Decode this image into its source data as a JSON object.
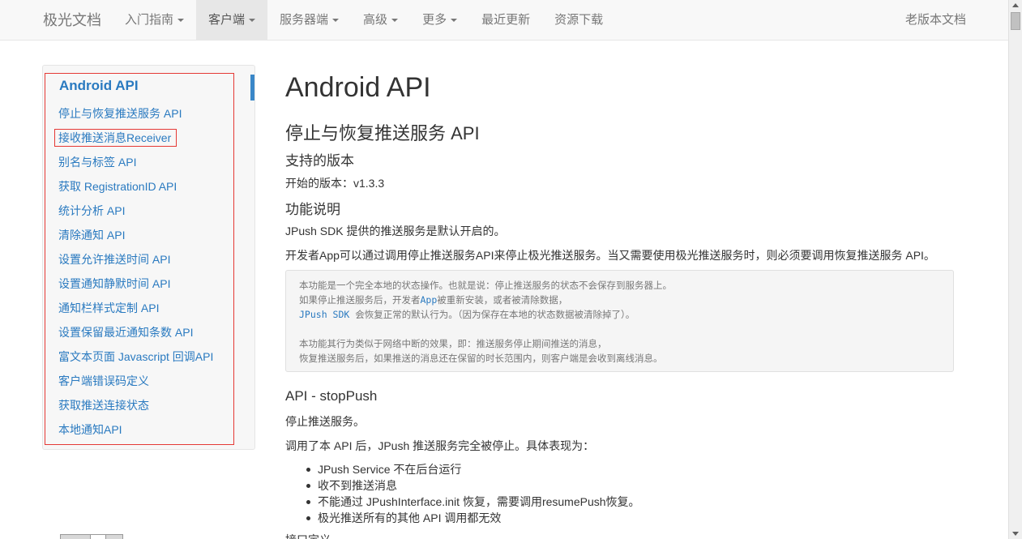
{
  "navbar": {
    "brand": "极光文档",
    "items": [
      {
        "label": "入门指南",
        "dropdown": true,
        "active": false
      },
      {
        "label": "客户端",
        "dropdown": true,
        "active": true
      },
      {
        "label": "服务器端",
        "dropdown": true,
        "active": false
      },
      {
        "label": "高级",
        "dropdown": true,
        "active": false
      },
      {
        "label": "更多",
        "dropdown": true,
        "active": false
      },
      {
        "label": "最近更新",
        "dropdown": false,
        "active": false
      },
      {
        "label": "资源下载",
        "dropdown": false,
        "active": false
      }
    ],
    "right": "老版本文档"
  },
  "sidebar": {
    "title": "Android API",
    "items": [
      {
        "label": "停止与恢复推送服务 API"
      },
      {
        "label": "接收推送消息Receiver"
      },
      {
        "label": "别名与标签 API"
      },
      {
        "label": "获取 RegistrationID API"
      },
      {
        "label": "统计分析 API"
      },
      {
        "label": "清除通知 API"
      },
      {
        "label": "设置允许推送时间 API"
      },
      {
        "label": "设置通知静默时间 API"
      },
      {
        "label": "通知栏样式定制 API"
      },
      {
        "label": "设置保留最近通知条数 API"
      },
      {
        "label": "富文本页面 Javascript 回调API"
      },
      {
        "label": "客户端错误码定义"
      },
      {
        "label": "获取推送连接状态"
      },
      {
        "label": "本地通知API"
      }
    ]
  },
  "content": {
    "title": "Android API",
    "section": "停止与恢复推送服务 API",
    "supported_heading": "支持的版本",
    "version_text": "开始的版本：v1.3.3",
    "feature_heading": "功能说明",
    "para1": "JPush SDK 提供的推送服务是默认开启的。",
    "para2": "开发者App可以通过调用停止推送服务API来停止极光推送服务。当又需要使用极光推送服务时，则必须要调用恢复推送服务 API。",
    "code": {
      "line1": "本功能是一个完全本地的状态操作。也就是说：停止推送服务的状态不会保存到服务器上。",
      "line2_a": "如果停止推送服务后，开发者",
      "line2_hl": "App",
      "line2_b": "被重新安装，或者被清除数据，",
      "line3_hl": "JPush SDK",
      "line3_b": " 会恢复正常的默认行为。（因为保存在本地的状态数据被清除掉了）。",
      "line5": "本功能其行为类似于网络中断的效果，即：推送服务停止期间推送的消息，",
      "line6": "恢复推送服务后，如果推送的消息还在保留的时长范围内，则客户端是会收到离线消息。"
    },
    "api_heading": "API - stopPush",
    "api_desc": "停止推送服务。",
    "api_detail": "调用了本 API 后，JPush 推送服务完全被停止。具体表现为：",
    "bullets": [
      "JPush Service 不在后台运行",
      "收不到推送消息",
      "不能通过 JPushInterface.init 恢复，需要调用resumePush恢复。",
      "极光推送所有的其他 API 调用都无效"
    ],
    "cut_text": "接口定义"
  }
}
